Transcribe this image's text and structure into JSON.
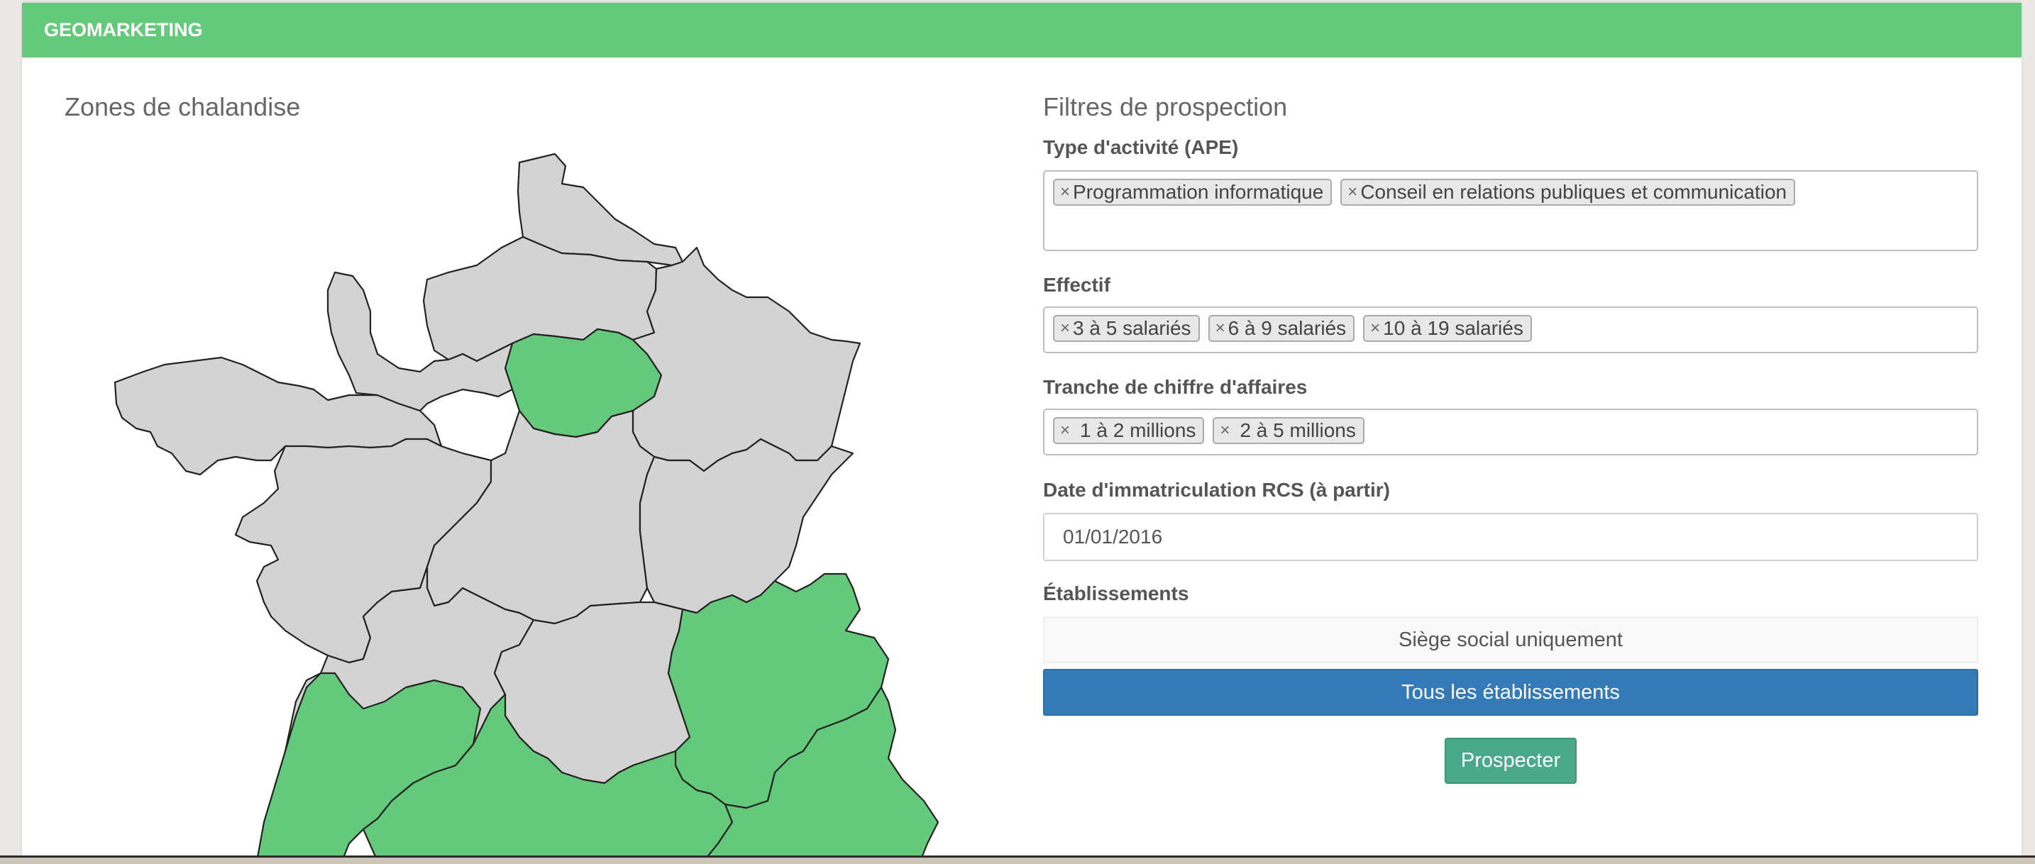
{
  "header": {
    "title": "GEOMARKETING"
  },
  "map": {
    "title": "Zones de chalandise",
    "colors": {
      "selected": "#64c97a",
      "unselected": "#d3d3d3",
      "border": "#222222"
    },
    "regions": [
      {
        "name": "Hauts-de-France",
        "selected": false
      },
      {
        "name": "Normandie",
        "selected": false
      },
      {
        "name": "Île-de-France",
        "selected": true
      },
      {
        "name": "Grand Est",
        "selected": false
      },
      {
        "name": "Bretagne",
        "selected": false
      },
      {
        "name": "Pays de la Loire",
        "selected": false
      },
      {
        "name": "Centre-Val de Loire",
        "selected": false
      },
      {
        "name": "Bourgogne-Franche-Comté",
        "selected": false
      },
      {
        "name": "Nouvelle-Aquitaine",
        "selected": false
      },
      {
        "name": "Auvergne-Rhône-Alpes",
        "selected": true
      },
      {
        "name": "Occitanie",
        "selected": true
      },
      {
        "name": "Provence-Alpes-Côte d'Azur",
        "selected": true
      }
    ]
  },
  "filters": {
    "title": "Filtres de prospection",
    "ape": {
      "label": "Type d'activité (APE)",
      "tags": [
        "Programmation informatique",
        "Conseil en relations publiques et communication"
      ]
    },
    "effectif": {
      "label": "Effectif",
      "tags": [
        "3 à 5 salariés",
        "6 à 9 salariés",
        "10 à 19 salariés"
      ]
    },
    "ca": {
      "label": "Tranche de chiffre d'affaires",
      "tags": [
        "1 à 2 millions",
        "2 à 5 millions"
      ]
    },
    "date": {
      "label": "Date d'immatriculation RCS (à partir)",
      "value": "01/01/2016"
    },
    "etablissements": {
      "label": "Établissements",
      "options": [
        "Siège social uniquement",
        "Tous les établissements"
      ],
      "selected": "Tous les établissements"
    },
    "submit_label": "Prospecter"
  },
  "icons": {
    "tag_remove": "×"
  },
  "theme": {
    "header_bg": "#64c97a",
    "active_button": "#337ab7",
    "submit_button": "#4aa98a"
  }
}
